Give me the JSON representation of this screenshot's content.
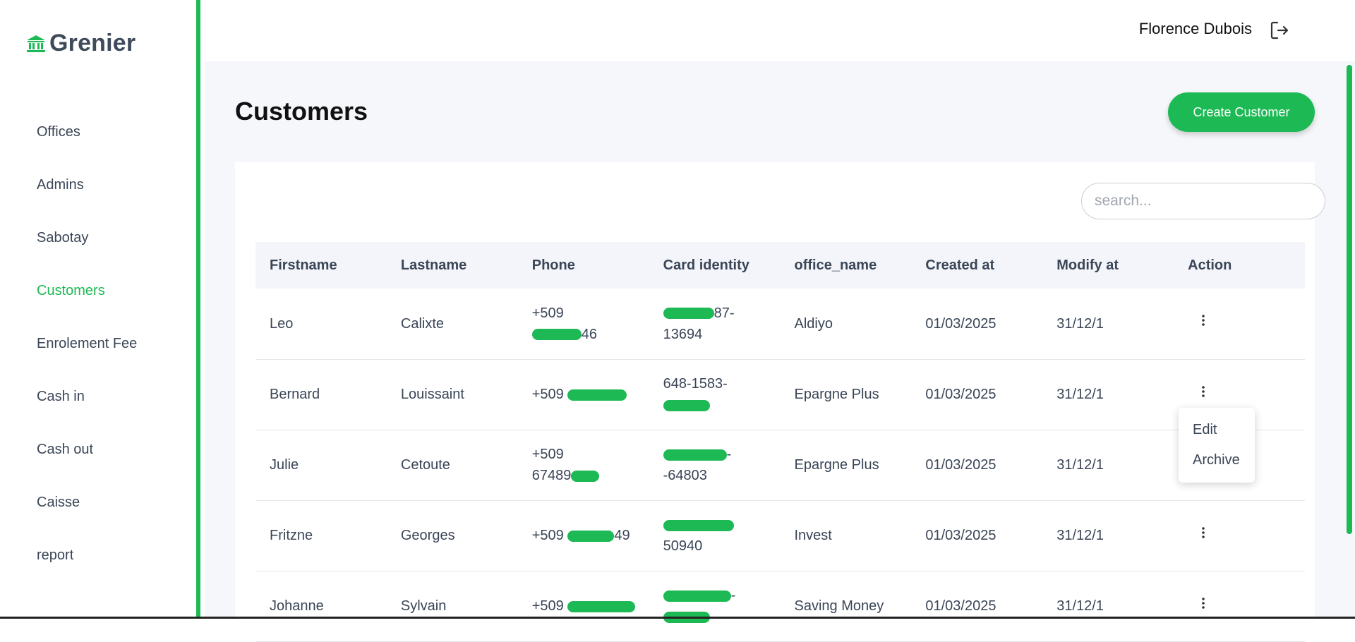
{
  "app": {
    "name": "Grenier"
  },
  "sidebar": {
    "items": [
      {
        "label": "Offices"
      },
      {
        "label": "Admins"
      },
      {
        "label": "Sabotay"
      },
      {
        "label": "Customers",
        "active": true
      },
      {
        "label": "Enrolement Fee"
      },
      {
        "label": "Cash in"
      },
      {
        "label": "Cash out"
      },
      {
        "label": "Caisse"
      },
      {
        "label": "report"
      }
    ]
  },
  "header": {
    "user_name": "Florence Dubois"
  },
  "page": {
    "title": "Customers",
    "create_label": "Create Customer",
    "search_placeholder": "search..."
  },
  "table": {
    "columns": [
      "Firstname",
      "Lastname",
      "Phone",
      "Card identity",
      "office_name",
      "Created at",
      "Modify at",
      "Action"
    ],
    "rows": [
      {
        "firstname": "Leo",
        "lastname": "Calixte",
        "phone": [
          "+509",
          "46"
        ],
        "card": [
          "87-",
          "13694"
        ],
        "office": "Aldiyo",
        "created": "01/03/2025",
        "modified": "31/12/1"
      },
      {
        "firstname": "Bernard",
        "lastname": "Louissaint",
        "phone": [
          "+509",
          ""
        ],
        "card": [
          "648-1583-",
          ""
        ],
        "office": "Epargne Plus",
        "created": "01/03/2025",
        "modified": "31/12/1"
      },
      {
        "firstname": "Julie",
        "lastname": "Cetoute",
        "phone": [
          "+509",
          "67489"
        ],
        "card": [
          "-",
          "-64803"
        ],
        "office": "Epargne Plus",
        "created": "01/03/2025",
        "modified": "31/12/1"
      },
      {
        "firstname": "Fritzne",
        "lastname": "Georges",
        "phone": [
          "+509",
          "49"
        ],
        "card": [
          "",
          "50940"
        ],
        "office": "Invest",
        "created": "01/03/2025",
        "modified": "31/12/1"
      },
      {
        "firstname": "Johanne",
        "lastname": "Sylvain",
        "phone": [
          "+509",
          ""
        ],
        "card": [
          "-",
          ""
        ],
        "office": "Saving Money",
        "created": "01/03/2025",
        "modified": "31/12/1"
      }
    ]
  },
  "action_menu": {
    "items": [
      "Edit",
      "Archive"
    ]
  },
  "colors": {
    "accent": "#1db954",
    "text": "#3a4556",
    "background": "#f6f7fb"
  },
  "icons": {
    "logo": "bank-icon",
    "logout": "logout-icon",
    "row_action": "more-vertical-icon"
  }
}
